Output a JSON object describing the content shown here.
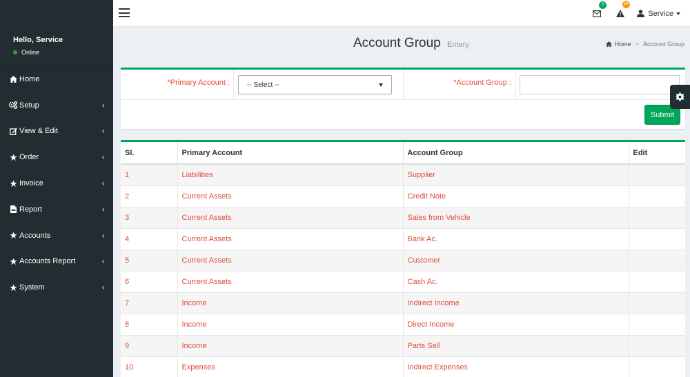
{
  "sidebar": {
    "greeting": "Hello, Service",
    "status": "Online",
    "items": [
      {
        "label": "Home",
        "icon": "home-icon",
        "has_children": false
      },
      {
        "label": "Setup",
        "icon": "cogs-icon",
        "has_children": true
      },
      {
        "label": "View & Edit",
        "icon": "edit-icon",
        "has_children": true
      },
      {
        "label": "Order",
        "icon": "star-icon",
        "has_children": true
      },
      {
        "label": "Invoice",
        "icon": "star-icon",
        "has_children": true
      },
      {
        "label": "Report",
        "icon": "file-icon",
        "has_children": true
      },
      {
        "label": "Accounts",
        "icon": "star-icon",
        "has_children": true
      },
      {
        "label": "Accounts Report",
        "icon": "star-icon",
        "has_children": true
      },
      {
        "label": "System",
        "icon": "star-icon",
        "has_children": true
      }
    ]
  },
  "topbar": {
    "mail_badge": "0",
    "alert_badge": "84",
    "user_name": "Service"
  },
  "header": {
    "title": "Account Group",
    "subtitle": "Entery",
    "breadcrumb_home": "Home",
    "breadcrumb_current": "Account Group"
  },
  "form": {
    "primary_account_label": "*Primary Account :",
    "primary_account_value": "-- Select --",
    "account_group_label": "*Account Group :",
    "account_group_value": "",
    "submit_label": "Submit"
  },
  "table": {
    "headers": [
      "Sl.",
      "Primary Account",
      "Account Group",
      "Edit"
    ],
    "rows": [
      {
        "sl": "1",
        "primary": "Liabilities",
        "group": "Supplier"
      },
      {
        "sl": "2",
        "primary": "Current Assets",
        "group": "Credit Note"
      },
      {
        "sl": "3",
        "primary": "Current Assets",
        "group": "Sales from Vehicle"
      },
      {
        "sl": "4",
        "primary": "Current Assets",
        "group": "Bank Ac."
      },
      {
        "sl": "5",
        "primary": "Current Assets",
        "group": "Customer"
      },
      {
        "sl": "6",
        "primary": "Current Assets",
        "group": "Cash Ac."
      },
      {
        "sl": "7",
        "primary": "Income",
        "group": "Indirect Income"
      },
      {
        "sl": "8",
        "primary": "Income",
        "group": "Direct Income"
      },
      {
        "sl": "9",
        "primary": "Income",
        "group": "Parts Sell"
      },
      {
        "sl": "10",
        "primary": "Expenses",
        "group": "Indirect Expenses"
      }
    ]
  },
  "colors": {
    "accent": "#00a65a",
    "link_red": "#dd4b39",
    "sidebar_bg": "#222d32"
  }
}
